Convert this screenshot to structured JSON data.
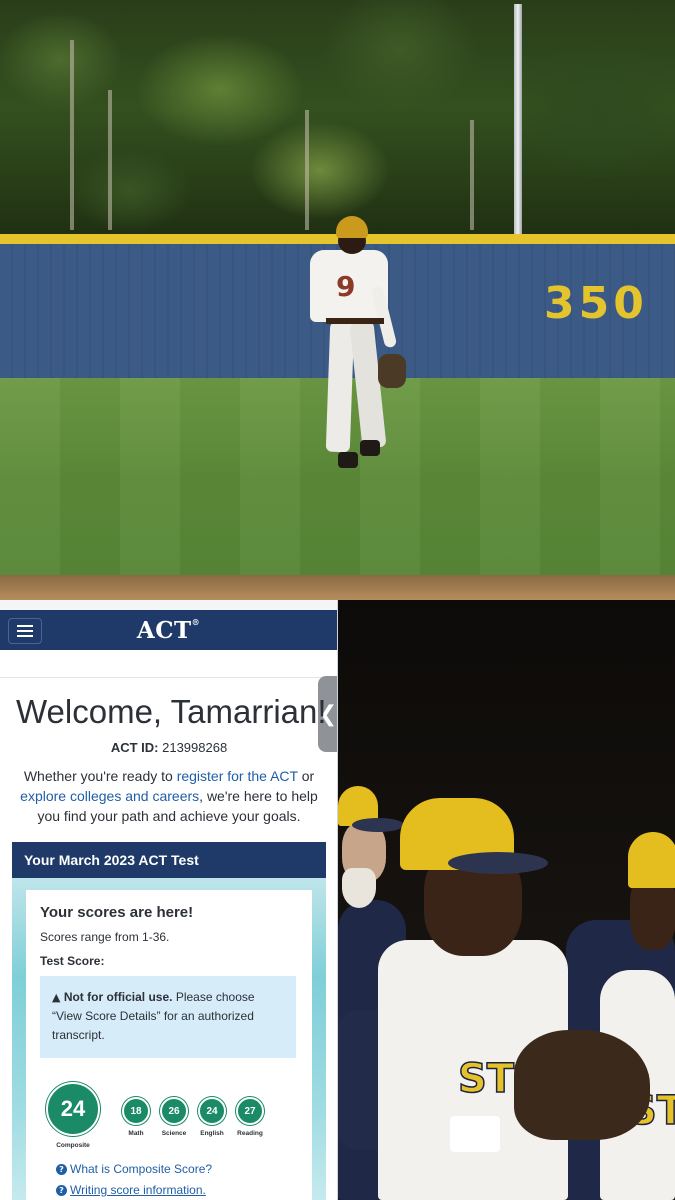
{
  "photo_top": {
    "fence_distance": "350",
    "player_number": "9"
  },
  "photo_bottom_right": {
    "jersey_text_front": "ST",
    "jersey_text_side": "ST"
  },
  "act": {
    "logo": "ACT",
    "welcome": "Welcome, Tamarrian!",
    "act_id_label": "ACT ID:",
    "act_id_value": "213998268",
    "intro": {
      "before_register": "Whether you're ready to ",
      "register_link": "register for the ACT",
      "between": " or",
      "explore_link": "explore colleges and careers",
      "after": ", we're here to help you find your path and achieve your goals."
    },
    "test_card": {
      "title": "Your March 2023 ACT Test",
      "scores_title": "Your scores are here!",
      "scores_range": "Scores range from 1-36.",
      "test_score_label": "Test Score:",
      "notice_bold": "Not for official use.",
      "notice_text": " Please choose “View Score Details” for an authorized transcript.",
      "scores": {
        "composite": {
          "value": "24",
          "label": "Composite"
        },
        "math": {
          "value": "18",
          "label": "Math"
        },
        "science": {
          "value": "26",
          "label": "Science"
        },
        "english": {
          "value": "24",
          "label": "English"
        },
        "reading": {
          "value": "27",
          "label": "Reading"
        }
      },
      "help_links": [
        "What is Composite Score?",
        "Writing score information."
      ]
    },
    "collapse_glyph": "❮"
  },
  "colors": {
    "act_navy": "#1f3a68",
    "score_green": "#1a8a67",
    "link_blue": "#1f5fa6",
    "fence_blue": "#3c5a86",
    "fence_yellow": "#e3c32e"
  },
  "icons": [
    "hamburger-menu-icon",
    "warning-triangle-icon",
    "help-circle-icon",
    "chevron-left-icon"
  ]
}
